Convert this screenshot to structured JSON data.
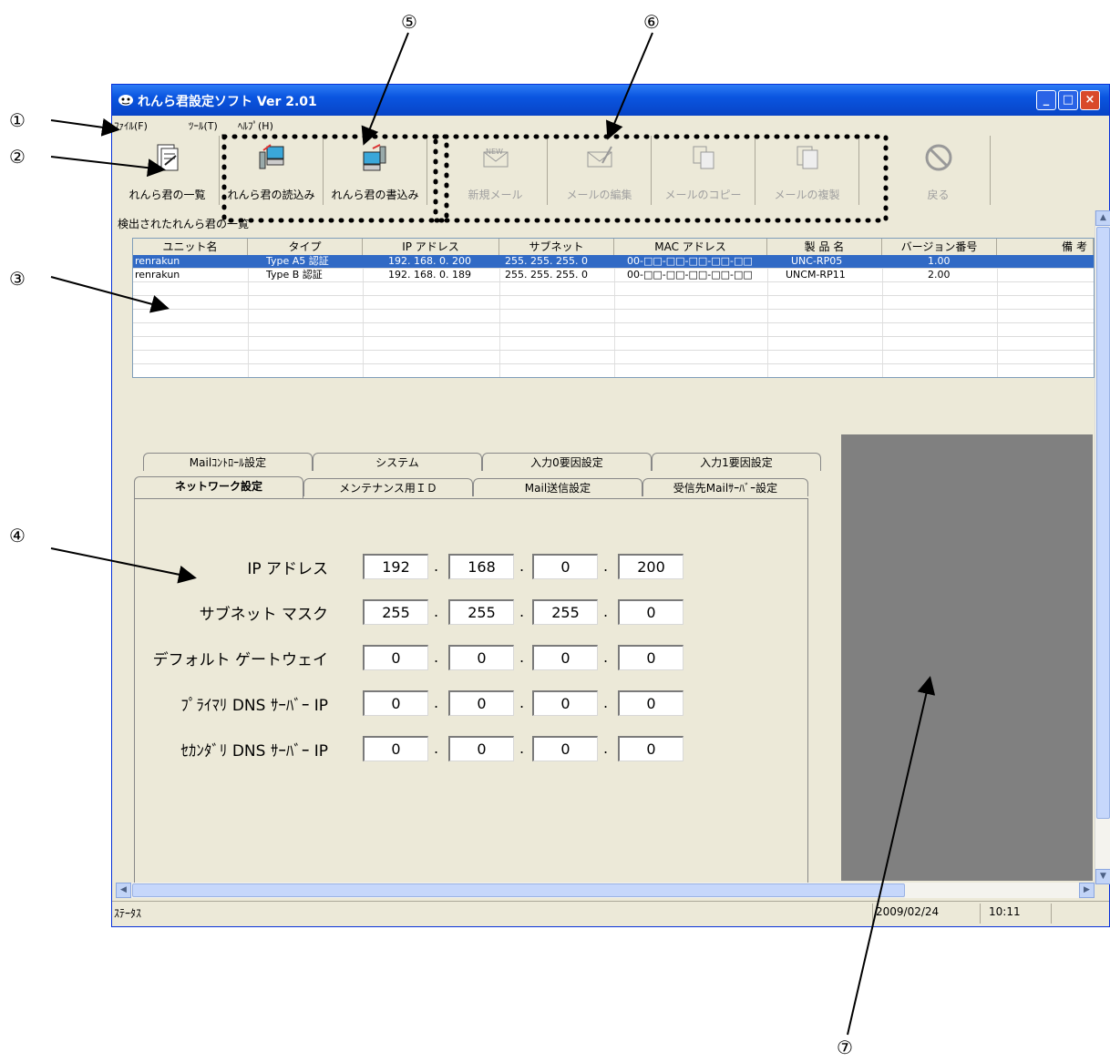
{
  "callouts": [
    "①",
    "②",
    "③",
    "④",
    "⑤",
    "⑥",
    "⑦"
  ],
  "window": {
    "title": "れんら君設定ソフト  Ver 2.01",
    "controls": {
      "minimize": "_",
      "maximize": "□",
      "close": "×"
    }
  },
  "menu": [
    "ﾌｧｲﾙ(F)",
    "ﾂｰﾙ(T)",
    "ﾍﾙﾌﾟ(H)"
  ],
  "toolbar": [
    {
      "label": "れんら君の一覧",
      "icon": "list-icon",
      "enabled": true
    },
    {
      "label": "れんら君の読込み",
      "icon": "read-icon",
      "enabled": true
    },
    {
      "label": "れんら君の書込み",
      "icon": "write-icon",
      "enabled": true
    },
    {
      "label": "新規メール",
      "icon": "new-mail-icon",
      "enabled": false
    },
    {
      "label": "メールの編集",
      "icon": "edit-mail-icon",
      "enabled": false
    },
    {
      "label": "メールのコピー",
      "icon": "copy-mail-icon",
      "enabled": false
    },
    {
      "label": "メールの複製",
      "icon": "duplicate-mail-icon",
      "enabled": false
    },
    {
      "label": "戻る",
      "icon": "back-icon",
      "enabled": false
    }
  ],
  "list": {
    "caption": "検出されたれんら君の一覧",
    "columns": [
      "ユニット名",
      "タイプ",
      "IP アドレス",
      "サブネット",
      "MAC アドレス",
      "製 品 名",
      "バージョン番号",
      "備  考"
    ],
    "rows": [
      [
        "renrakun",
        "Type A5 認証",
        "192. 168. 0. 200",
        "255. 255. 255.  0",
        "00-□□-□□-□□-□□-□□",
        "UNC-RP05",
        "1.00",
        ""
      ],
      [
        "renrakun",
        "Type B 認証",
        "192. 168. 0. 189",
        "255. 255. 255.  0",
        "00-□□-□□-□□-□□-□□",
        "UNCM-RP11",
        "2.00",
        ""
      ]
    ],
    "selected_row": 0
  },
  "tabs": {
    "back_row": [
      "Mailｺﾝﾄﾛｰﾙ設定",
      "システム",
      "入力0要因設定",
      "入力1要因設定"
    ],
    "front_row": [
      "ネットワーク設定",
      "メンテナンス用ＩＤ",
      "Mail送信設定",
      "受信先Mailｻｰﾊﾞｰ設定"
    ],
    "active": "ネットワーク設定"
  },
  "network": {
    "fields": [
      {
        "label": "IP アドレス",
        "octets": [
          "192",
          "168",
          "0",
          "200"
        ]
      },
      {
        "label": "サブネット マスク",
        "octets": [
          "255",
          "255",
          "255",
          "0"
        ]
      },
      {
        "label": "デフォルト ゲートウェイ",
        "octets": [
          "0",
          "0",
          "0",
          "0"
        ]
      },
      {
        "label": "ﾌﾟﾗｲﾏﾘ DNS ｻｰﾊﾞｰ IP",
        "octets": [
          "0",
          "0",
          "0",
          "0"
        ]
      },
      {
        "label": "ｾｶﾝﾀﾞﾘ DNS ｻｰﾊﾞｰ IP",
        "octets": [
          "0",
          "0",
          "0",
          "0"
        ]
      }
    ],
    "separator": "."
  },
  "status": {
    "label": "ｽﾃｰﾀｽ",
    "date": "2009/02/24",
    "time": "10:11"
  }
}
